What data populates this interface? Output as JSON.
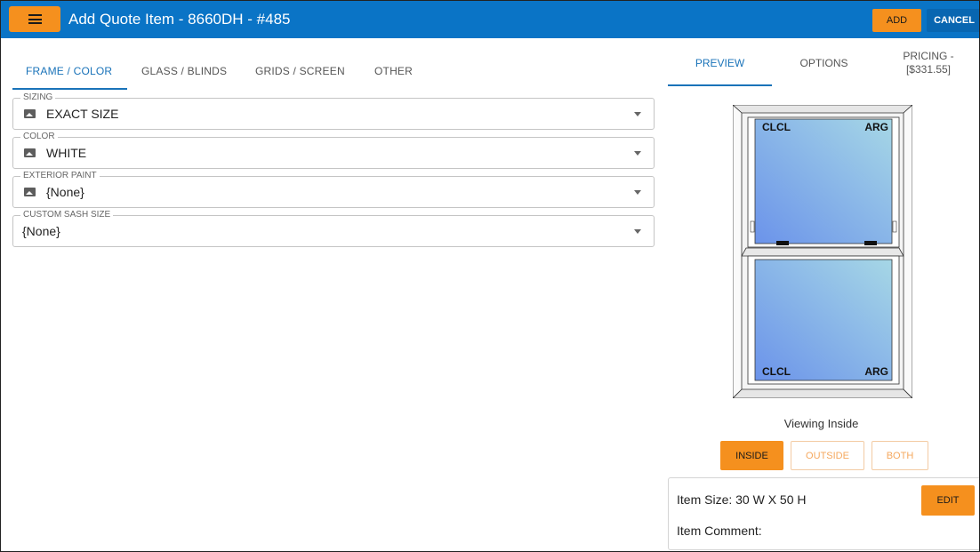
{
  "header": {
    "title": "Add Quote Item - 8660DH - #485",
    "add_label": "ADD",
    "cancel_label": "CANCEL",
    "accent": "#0a74c6",
    "button_color": "#f5901e"
  },
  "left_tabs": [
    {
      "label": "FRAME / COLOR",
      "active": true
    },
    {
      "label": "GLASS / BLINDS"
    },
    {
      "label": "GRIDS / SCREEN"
    },
    {
      "label": "OTHER"
    }
  ],
  "fields": [
    {
      "label": "SIZING",
      "value": "EXACT SIZE",
      "icon": "image-icon"
    },
    {
      "label": "COLOR",
      "value": "WHITE",
      "icon": "image-icon"
    },
    {
      "label": "EXTERIOR PAINT",
      "value": "{None}",
      "icon": "image-icon"
    },
    {
      "label": "CUSTOM SASH SIZE",
      "value": "{None}"
    }
  ],
  "right_tabs": [
    {
      "label": "PREVIEW",
      "active": true
    },
    {
      "label": "OPTIONS"
    },
    {
      "label": "PRICING -",
      "sub": "[$331.55]"
    }
  ],
  "preview": {
    "top_sash": {
      "left": "CLCL",
      "right": "ARG"
    },
    "bottom_sash": {
      "left": "CLCL",
      "right": "ARG"
    },
    "viewing_text": "Viewing Inside",
    "view_buttons": [
      {
        "label": "INSIDE",
        "active": true
      },
      {
        "label": "OUTSIDE"
      },
      {
        "label": "BOTH"
      }
    ]
  },
  "item": {
    "size": "Item Size:  30 W X 50 H",
    "comment": "Item Comment:",
    "edit_label": "EDIT"
  }
}
